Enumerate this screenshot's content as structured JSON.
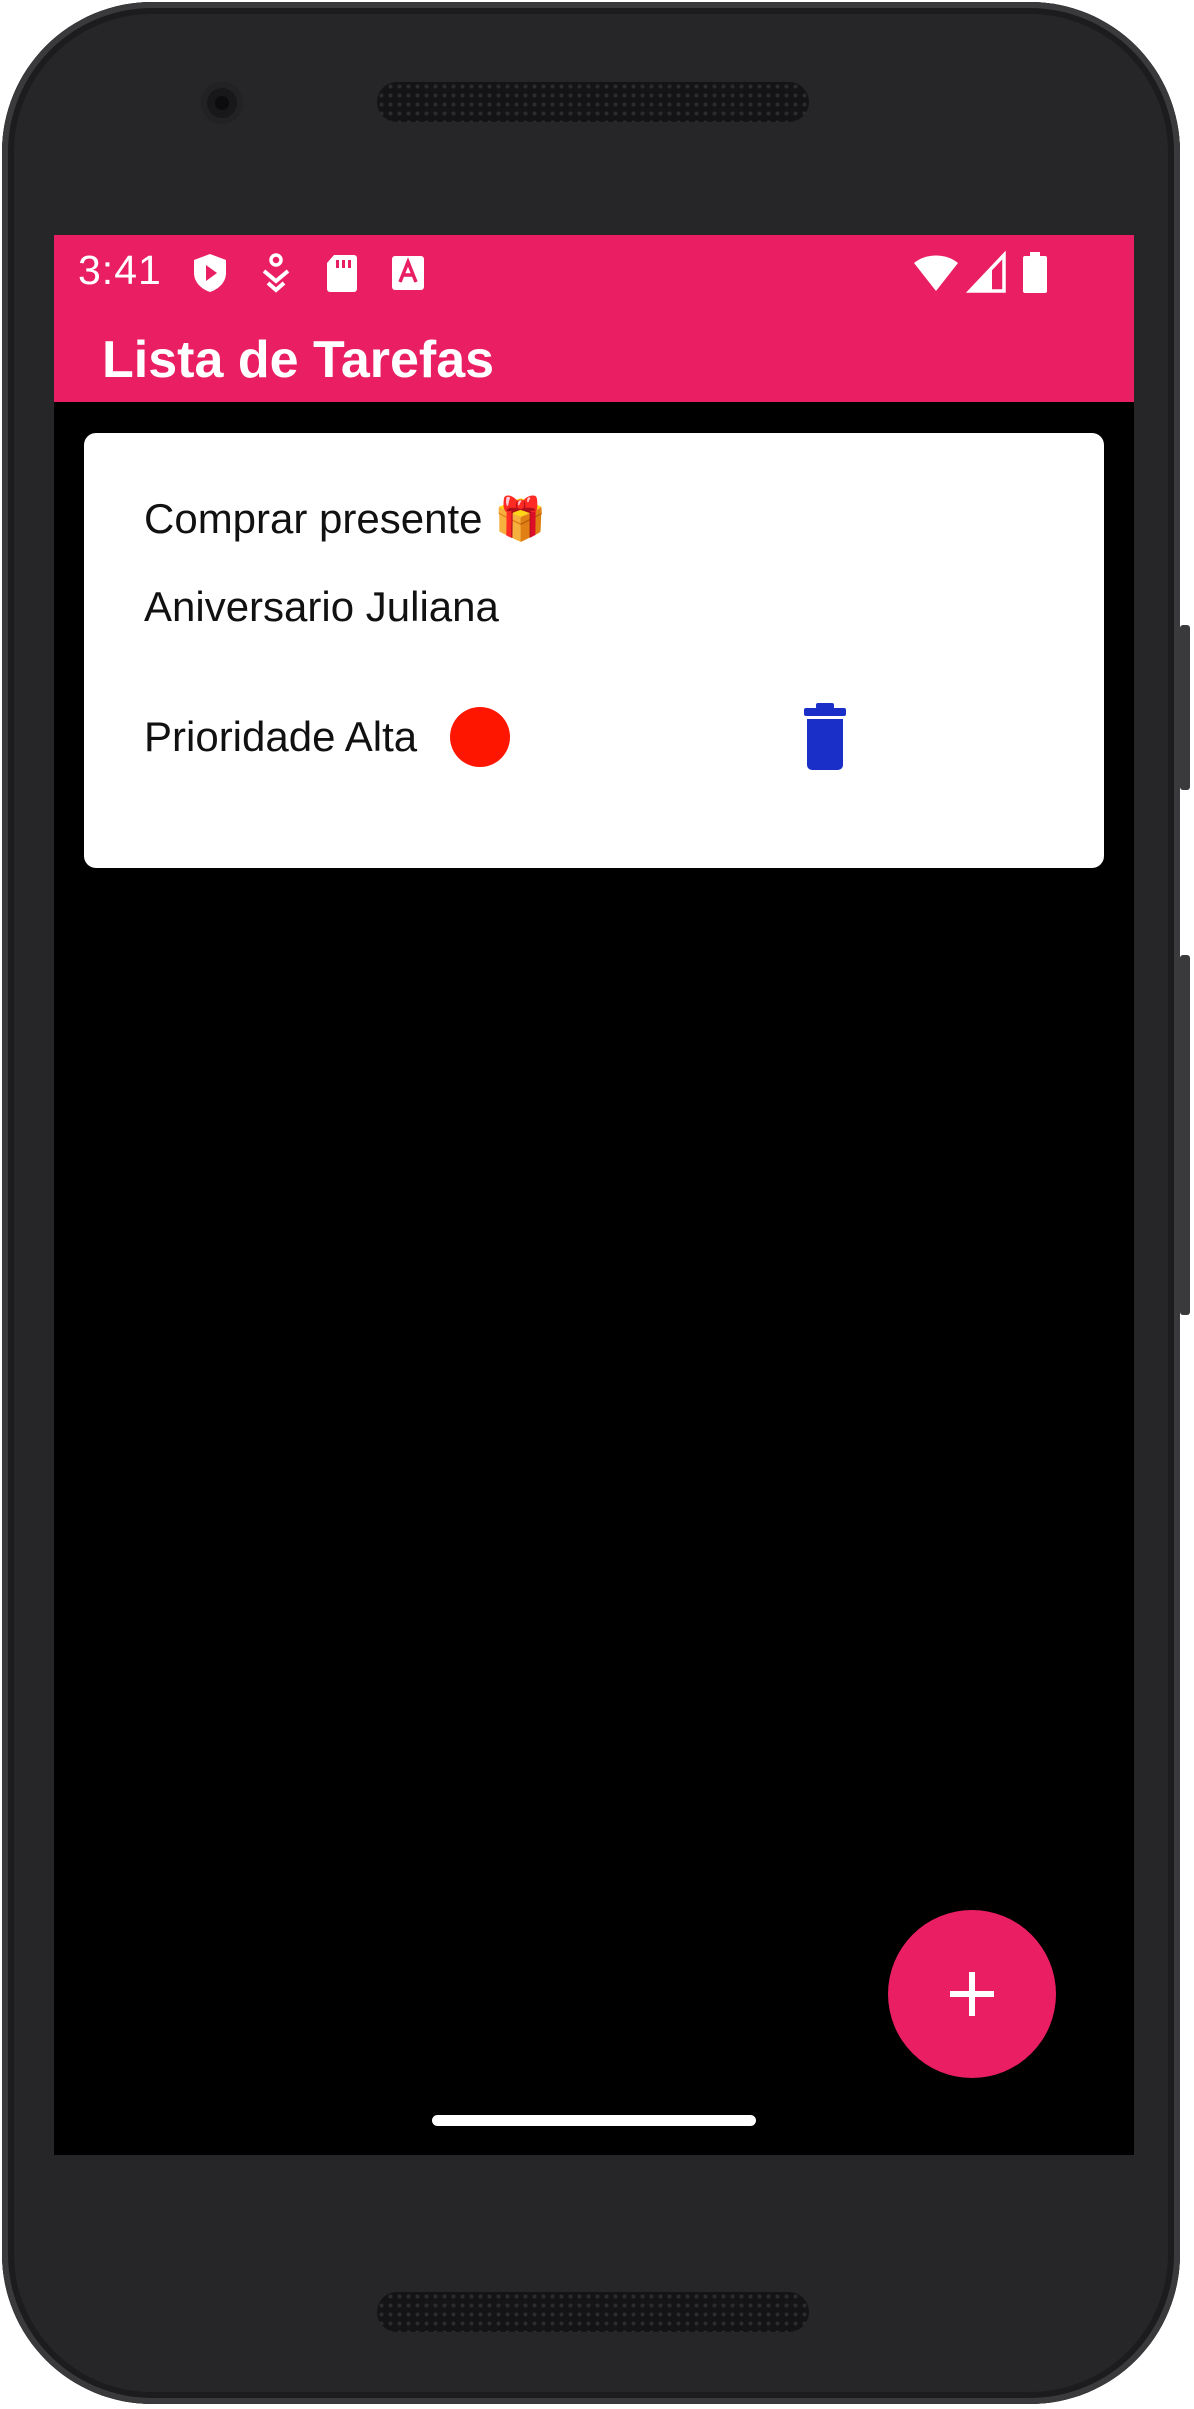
{
  "status_bar": {
    "time": "3:41",
    "left_icons": [
      "play-protect-icon",
      "download-icon",
      "sd-card-icon",
      "font-a-icon"
    ],
    "right_icons": [
      "wifi-icon",
      "signal-icon",
      "battery-icon"
    ]
  },
  "app_bar": {
    "title": "Lista de Tarefas"
  },
  "tasks": [
    {
      "title": "Comprar presente 🎁",
      "description": "Aniversario Juliana",
      "priority_label": "Prioridade Alta",
      "priority_color": "#FF1600",
      "delete_icon": "trash-icon"
    }
  ],
  "fab": {
    "icon": "plus-icon"
  },
  "colors": {
    "primary": "#E91E63",
    "background": "#000000",
    "card": "#FFFFFF",
    "delete_icon": "#1A2FC8"
  }
}
